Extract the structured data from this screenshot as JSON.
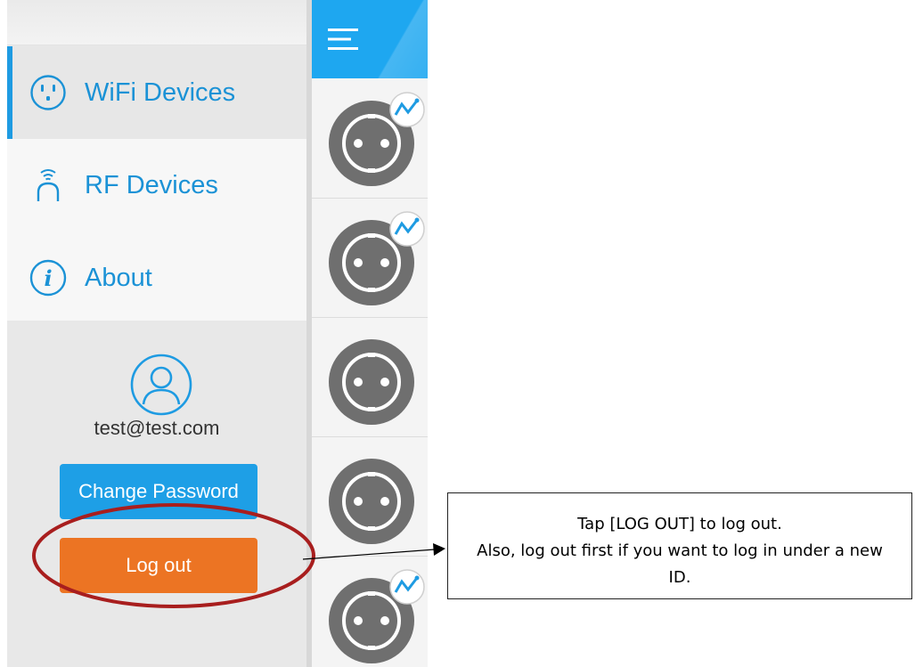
{
  "drawer": {
    "menu": [
      {
        "label": "WiFi Devices",
        "icon": "outlet-icon",
        "active": true
      },
      {
        "label": "RF Devices",
        "icon": "rf-remote-icon",
        "active": false
      },
      {
        "label": "About",
        "icon": "info-icon",
        "active": false
      }
    ],
    "account": {
      "email": "test@test.com",
      "change_password_label": "Change Password",
      "logout_label": "Log out"
    }
  },
  "devices_panel": {
    "header_icon": "hamburger-menu-icon",
    "device_count": 5
  },
  "annotation": {
    "line1": "Tap [LOG OUT] to log out.",
    "line2": "Also, log out first if you want to log in under a new ID."
  },
  "colors": {
    "accent_blue": "#1e9fe6",
    "logout_orange": "#ec7423",
    "highlight_red": "#a81e1e"
  }
}
